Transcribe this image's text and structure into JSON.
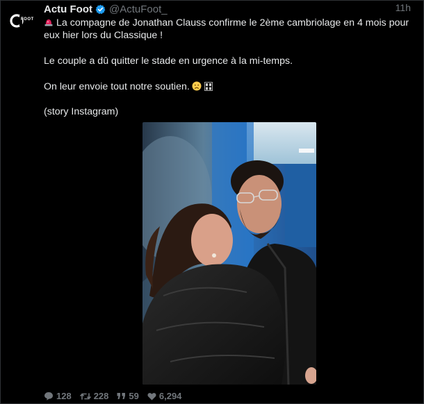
{
  "account": {
    "display_name": "Actu Foot",
    "handle": "@ActuFoot_",
    "avatar_label": "FOOT",
    "verified": true
  },
  "tweet": {
    "time": "11h",
    "line1": "La compagne de Jonathan Clauss confirme le 2ème cambriolage en 4 mois pour eux hier lors du Classique !",
    "line2": "Le couple a dû quitter le stade en urgence à la mi-temps.",
    "line3": "On leur envoie tout notre soutien.",
    "line4": "(story Instagram)",
    "emoji_siren": "siren-emoji",
    "emoji_sad": "sad-face-emoji",
    "emoji_flag": "flag-emoji"
  },
  "stats": {
    "replies": "128",
    "retweets": "228",
    "quotes": "59",
    "likes": "6,294"
  },
  "colors": {
    "background": "#000000",
    "text": "#e7e9ea",
    "muted": "#71767b",
    "verified": "#1d9bf0"
  }
}
